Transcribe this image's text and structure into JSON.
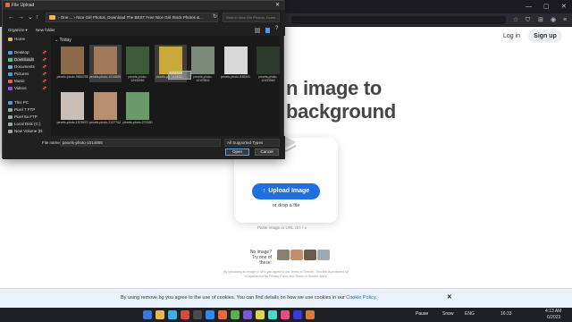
{
  "dialog": {
    "title": "File Upload",
    "close_glyph": "✕",
    "nav": {
      "back": "←",
      "forward": "→",
      "up": "↑",
      "dropdown": "⌄",
      "refresh": "↻"
    },
    "path": "›  One ...  ›  Nice Girl Photos, Download The BEST Free Nice Girl Stock Photos &...",
    "search_placeholder": "Search Nice Girl Photos, Down...",
    "organize": "Organize ▾",
    "new_folder": "New folder",
    "sidebar": [
      {
        "label": "Home",
        "icon": "home-icon",
        "color": "#e8b84a",
        "pinned": false
      },
      {
        "label": "Desktop",
        "icon": "desktop-icon",
        "color": "#4a9be8",
        "pinned": true
      },
      {
        "label": "Downloads",
        "icon": "downloads-icon",
        "color": "#4ac08a",
        "pinned": true
      },
      {
        "label": "Documents",
        "icon": "documents-icon",
        "color": "#7fa7d8",
        "pinned": true
      },
      {
        "label": "Pictures",
        "icon": "pictures-icon",
        "color": "#4a9be8",
        "pinned": true
      },
      {
        "label": "Music",
        "icon": "music-icon",
        "color": "#e8604a",
        "pinned": true
      },
      {
        "label": "Videos",
        "icon": "videos-icon",
        "color": "#a04ae8",
        "pinned": true
      },
      {
        "label": "This PC",
        "icon": "pc-icon",
        "color": "#4a9be8",
        "pinned": false
      },
      {
        "label": "Pixel 7 FTP",
        "icon": "drive-icon",
        "color": "#9aa",
        "pinned": false
      },
      {
        "label": "Pixel 5a FTP",
        "icon": "drive-icon",
        "color": "#9aa",
        "pinned": false
      },
      {
        "label": "Local Disk (C:)",
        "icon": "drive-icon",
        "color": "#9aa",
        "pinned": false
      },
      {
        "label": "New Volume (D:",
        "icon": "drive-icon",
        "color": "#9aa",
        "pinned": false
      }
    ],
    "group_header": "Today",
    "files": [
      {
        "name": "pexels-photo-9653755",
        "color": "#8a6a4a",
        "selected": false
      },
      {
        "name": "pexels-photo-1014855",
        "color": "#a07a5a",
        "selected": true
      },
      {
        "name": "pexels-photo-12430051",
        "color": "#3d5a3a",
        "selected": false
      },
      {
        "name": "pexels-ph...o-1123...",
        "color": "#c9a93a",
        "selected": true
      },
      {
        "name": "pexels-photo-12103841",
        "color": "#7a8a7a",
        "selected": false
      },
      {
        "name": "pexels-photo-848341",
        "color": "#d8d8d8",
        "selected": false
      },
      {
        "name": "pexels-photo-12433082",
        "color": "#2e3a2e",
        "selected": false
      },
      {
        "name": "pexels-photo-1578970",
        "color": "#c8c0b8",
        "selected": false
      },
      {
        "name": "pexels-photo-2127742",
        "color": "#b89070",
        "selected": false
      },
      {
        "name": "pexels-photo-270330",
        "color": "#6a9a6a",
        "selected": false
      }
    ],
    "file_name_label": "File name:",
    "file_name_value": "pexels-photo-1014855",
    "file_type": "All Supported Types",
    "open_label": "Open",
    "cancel_label": "Cancel"
  },
  "site": {
    "login": "Log in",
    "signup": "Sign up",
    "hero_line1": "n image to",
    "hero_line2": "background",
    "upload_label": "Upload Image",
    "upload_icon": "↑",
    "drop_text": "or drop a file",
    "paste_text": "Paste image or URL   ctrl  +  v",
    "no_image_line1": "No image?",
    "no_image_line2": "Try one of these:",
    "sample_colors": [
      "#8a8070",
      "#c09070",
      "#6a5a4a",
      "#a0a8b0"
    ],
    "fine_print": "By uploading an image or URL you agree to our Terms of Service. This site is protected by hCaptcha and its Privacy Policy and Terms of Service apply."
  },
  "cookie": {
    "text": "By using remove.bg you agree to the use of cookies. You can find details on how we use cookies in our",
    "link": "Cookie Policy.",
    "close": "✕"
  },
  "browser": {
    "minimize": "—",
    "maximize": "▢",
    "close": "✕"
  },
  "taskbar": {
    "pause_label": "Pause",
    "snow_label": "Snow",
    "lang": "ENG",
    "time": "16:33",
    "time2": "4:13 AM",
    "date": "6/2023",
    "app_colors": [
      "#3a78d8",
      "#e8b84a",
      "#3ab0e8",
      "#d84a3a",
      "#4a4a4a",
      "#2a8af0",
      "#e86a3a",
      "#5ab04a",
      "#7a5ad8",
      "#d8d84a",
      "#4ad8c8",
      "#e84a8a",
      "#3a3ad8",
      "#d87a3a"
    ]
  }
}
